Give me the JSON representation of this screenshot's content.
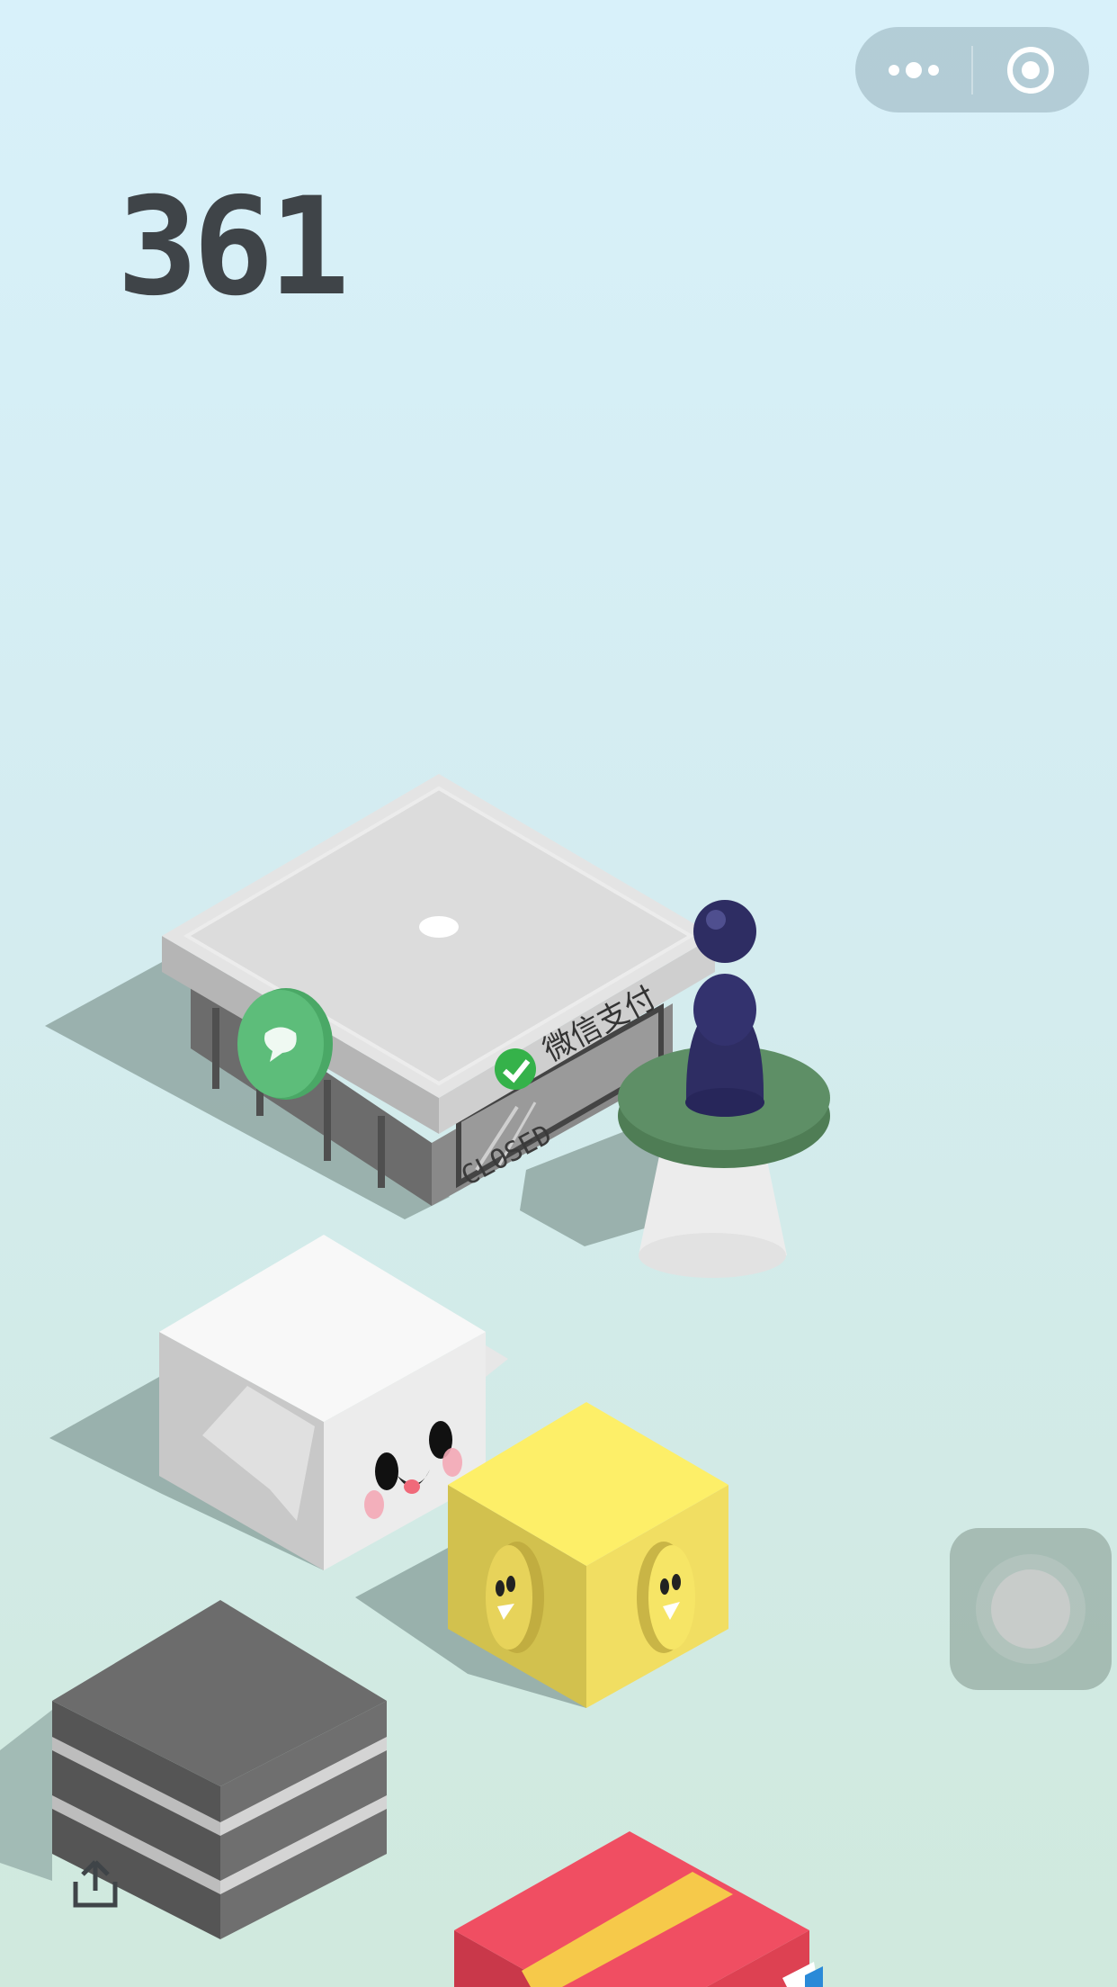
{
  "score": "361",
  "menu_button": {
    "icon": "more-dots-icon"
  },
  "close_button": {
    "icon": "target-circle-icon"
  },
  "share_button": {
    "icon": "share-icon"
  },
  "floating_button": {
    "icon": "floating-ball-icon"
  },
  "platforms": {
    "store": {
      "sign_text": "微信支付",
      "door_text": "CLOSED"
    }
  },
  "colors": {
    "sky_top": "#d8f1fa",
    "ground": "#d0e9dd",
    "score": "#3f4448",
    "player": "#2e2d63",
    "stool_top": "#5e8f66",
    "yellow_cube": "#f5e365",
    "gift_red": "#f04e62"
  }
}
